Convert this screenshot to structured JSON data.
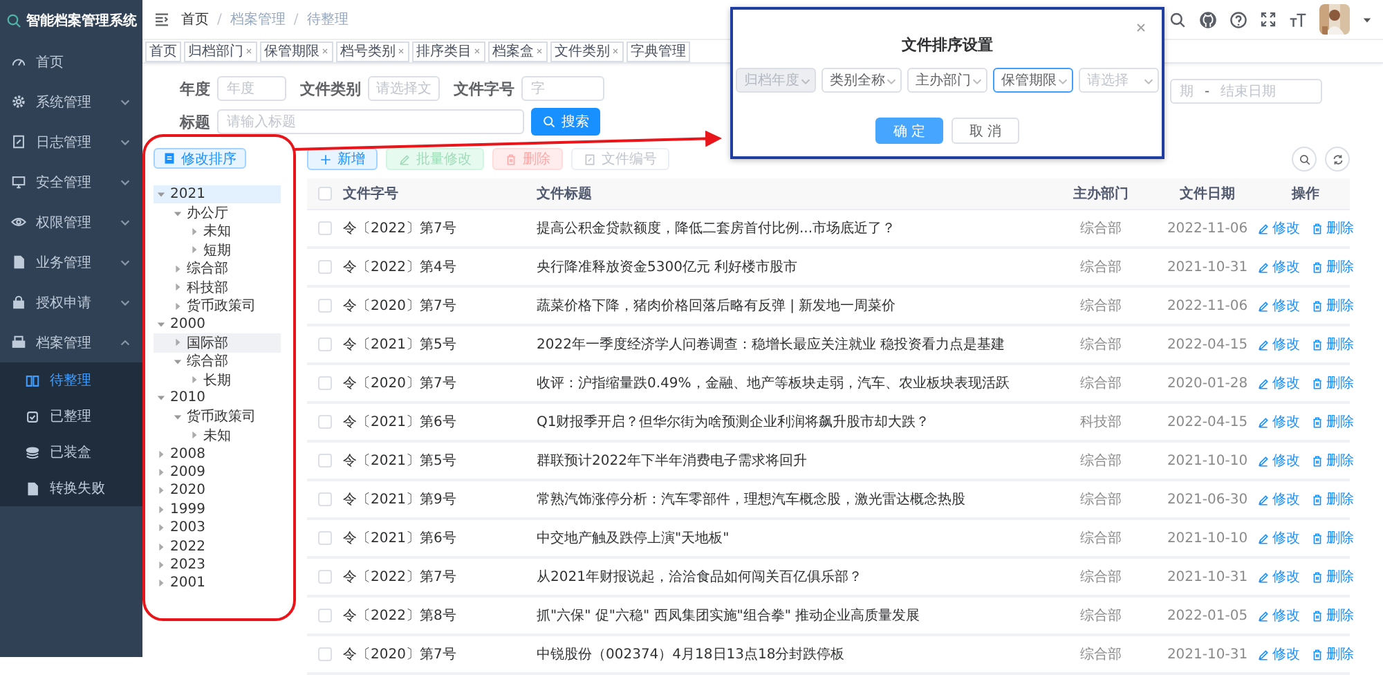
{
  "app": {
    "title": "智能档案管理系统"
  },
  "sidebar": {
    "items": [
      {
        "label": "首页",
        "kind": "link"
      },
      {
        "label": "系统管理",
        "kind": "menu",
        "expanded": false
      },
      {
        "label": "日志管理",
        "kind": "menu",
        "expanded": false
      },
      {
        "label": "安全管理",
        "kind": "menu",
        "expanded": false
      },
      {
        "label": "权限管理",
        "kind": "menu",
        "expanded": false
      },
      {
        "label": "业务管理",
        "kind": "menu",
        "expanded": false
      },
      {
        "label": "授权申请",
        "kind": "menu",
        "expanded": false
      },
      {
        "label": "档案管理",
        "kind": "menu",
        "expanded": true,
        "children": [
          {
            "label": "待整理",
            "selected": true
          },
          {
            "label": "已整理",
            "selected": false
          },
          {
            "label": "已装盒",
            "selected": false
          },
          {
            "label": "转换失败",
            "selected": false
          }
        ]
      }
    ]
  },
  "header": {
    "breadcrumb": [
      "首页",
      "档案管理",
      "待整理"
    ],
    "separator": "/"
  },
  "tags": [
    {
      "label": "首页",
      "closable": false
    },
    {
      "label": "归档部门",
      "closable": true
    },
    {
      "label": "保管期限",
      "closable": true
    },
    {
      "label": "档号类别",
      "closable": true
    },
    {
      "label": "排序类目",
      "closable": true
    },
    {
      "label": "档案盒",
      "closable": true
    },
    {
      "label": "文件类别",
      "closable": true
    },
    {
      "label": "字典管理",
      "closable": false
    }
  ],
  "search_form": {
    "fields": [
      {
        "label": "年度",
        "placeholder": "年度",
        "kind": "input"
      },
      {
        "label": "文件类别",
        "placeholder": "请选择文",
        "kind": "select"
      },
      {
        "label": "文件字号",
        "placeholder": "字",
        "kind": "input"
      }
    ],
    "date_range": {
      "start": "期",
      "separator": "-",
      "end": "结束日期"
    },
    "title_field": {
      "label": "标题",
      "placeholder": "请输入标题"
    },
    "search_button": "搜索"
  },
  "tree_panel": {
    "sort_button": "修改排序",
    "tree": [
      {
        "label": "2021",
        "expanded": true,
        "selected": true,
        "hovered": false,
        "children": [
          {
            "label": "办公厅",
            "expanded": true,
            "selected": false,
            "hovered": false,
            "children": [
              {
                "label": "未知",
                "expanded": false,
                "selected": false,
                "hovered": false
              },
              {
                "label": "短期",
                "expanded": false,
                "selected": false,
                "hovered": false
              }
            ]
          },
          {
            "label": "综合部",
            "expanded": false,
            "selected": false,
            "hovered": false
          },
          {
            "label": "科技部",
            "expanded": false,
            "selected": false,
            "hovered": false
          },
          {
            "label": "货币政策司",
            "expanded": false,
            "selected": false,
            "hovered": false
          }
        ]
      },
      {
        "label": "2000",
        "expanded": true,
        "selected": false,
        "hovered": false,
        "children": [
          {
            "label": "国际部",
            "expanded": false,
            "selected": false,
            "hovered": true
          },
          {
            "label": "综合部",
            "expanded": true,
            "selected": false,
            "hovered": false,
            "children": [
              {
                "label": "长期",
                "expanded": false,
                "selected": false,
                "hovered": false
              }
            ]
          }
        ]
      },
      {
        "label": "2010",
        "expanded": true,
        "selected": false,
        "hovered": false,
        "children": [
          {
            "label": "货币政策司",
            "expanded": true,
            "selected": false,
            "hovered": false,
            "children": [
              {
                "label": "未知",
                "expanded": false,
                "selected": false,
                "hovered": false
              }
            ]
          }
        ]
      },
      {
        "label": "2008",
        "expanded": false,
        "selected": false,
        "hovered": false
      },
      {
        "label": "2009",
        "expanded": false,
        "selected": false,
        "hovered": false
      },
      {
        "label": "2020",
        "expanded": false,
        "selected": false,
        "hovered": false
      },
      {
        "label": "1999",
        "expanded": false,
        "selected": false,
        "hovered": false
      },
      {
        "label": "2003",
        "expanded": false,
        "selected": false,
        "hovered": false
      },
      {
        "label": "2022",
        "expanded": false,
        "selected": false,
        "hovered": false
      },
      {
        "label": "2023",
        "expanded": false,
        "selected": false,
        "hovered": false
      },
      {
        "label": "2001",
        "expanded": false,
        "selected": false,
        "hovered": false
      }
    ]
  },
  "toolbar": {
    "buttons": [
      {
        "label": "新增",
        "kind": "add"
      },
      {
        "label": "批量修改",
        "kind": "batch"
      },
      {
        "label": "删除",
        "kind": "delete"
      },
      {
        "label": "文件编号",
        "kind": "number"
      }
    ]
  },
  "table": {
    "header_checked": false,
    "columns": [
      "文件字号",
      "文件标题",
      "主办部门",
      "文件日期",
      "操作"
    ],
    "rows": [
      {
        "checked": false,
        "doc_no": "令〔2022〕第7号",
        "title": "提高公积金贷款额度，降低二套房首付比例...市场底近了？",
        "dept": "综合部",
        "date": "2022-11-06",
        "edit": "修改",
        "delete": "删除"
      },
      {
        "checked": false,
        "doc_no": "令〔2022〕第4号",
        "title": "央行降准释放资金5300亿元 利好楼市股市",
        "dept": "综合部",
        "date": "2021-10-31",
        "edit": "修改",
        "delete": "删除"
      },
      {
        "checked": false,
        "doc_no": "令〔2020〕第7号",
        "title": "蔬菜价格下降，猪肉价格回落后略有反弹 | 新发地一周菜价",
        "dept": "综合部",
        "date": "2022-11-06",
        "edit": "修改",
        "delete": "删除"
      },
      {
        "checked": false,
        "doc_no": "令〔2021〕第5号",
        "title": "2022年一季度经济学人问卷调查：稳增长最应关注就业 稳投资看力点是基建",
        "dept": "综合部",
        "date": "2022-04-15",
        "edit": "修改",
        "delete": "删除"
      },
      {
        "checked": false,
        "doc_no": "令〔2020〕第7号",
        "title": "收评：沪指缩量跌0.49%，金融、地产等板块走弱，汽车、农业板块表现活跃",
        "dept": "综合部",
        "date": "2020-01-28",
        "edit": "修改",
        "delete": "删除"
      },
      {
        "checked": false,
        "doc_no": "令〔2021〕第6号",
        "title": "Q1财报季开启？但华尔街为啥预测企业利润将飙升股市却大跌？",
        "dept": "科技部",
        "date": "2022-04-15",
        "edit": "修改",
        "delete": "删除"
      },
      {
        "checked": false,
        "doc_no": "令〔2021〕第5号",
        "title": "群联预计2022年下半年消费电子需求将回升",
        "dept": "综合部",
        "date": "2021-10-10",
        "edit": "修改",
        "delete": "删除"
      },
      {
        "checked": false,
        "doc_no": "令〔2021〕第9号",
        "title": "常熟汽饰涨停分析：汽车零部件，理想汽车概念股，激光雷达概念热股",
        "dept": "综合部",
        "date": "2021-06-30",
        "edit": "修改",
        "delete": "删除"
      },
      {
        "checked": false,
        "doc_no": "令〔2021〕第6号",
        "title": "中交地产触及跌停上演\"天地板\"",
        "dept": "综合部",
        "date": "2021-10-10",
        "edit": "修改",
        "delete": "删除"
      },
      {
        "checked": false,
        "doc_no": "令〔2022〕第7号",
        "title": "从2021年财报说起，洽洽食品如何闯关百亿俱乐部？",
        "dept": "综合部",
        "date": "2021-10-31",
        "edit": "修改",
        "delete": "删除"
      },
      {
        "checked": false,
        "doc_no": "令〔2022〕第8号",
        "title": "抓\"六保\" 促\"六稳\" 西凤集团实施\"组合拳\" 推动企业高质量发展",
        "dept": "综合部",
        "date": "2022-01-05",
        "edit": "修改",
        "delete": "删除"
      },
      {
        "checked": false,
        "doc_no": "令〔2020〕第7号",
        "title": "中锐股份（002374）4月18日13点18分封跌停板",
        "dept": "综合部",
        "date": "2021-10-31",
        "edit": "修改",
        "delete": "删除"
      }
    ]
  },
  "sort_dialog": {
    "title": "文件排序设置",
    "selects": [
      {
        "value": "归档年度",
        "disabled": true,
        "focused": false
      },
      {
        "value": "类别全称",
        "disabled": false,
        "focused": false
      },
      {
        "value": "主办部门",
        "disabled": false,
        "focused": false
      },
      {
        "value": "保管期限",
        "disabled": false,
        "focused": true
      },
      {
        "placeholder": "请选择",
        "disabled": false,
        "focused": false
      }
    ],
    "buttons": [
      {
        "label": "确 定",
        "kind": "primary"
      },
      {
        "label": "取 消",
        "kind": "default"
      }
    ]
  }
}
